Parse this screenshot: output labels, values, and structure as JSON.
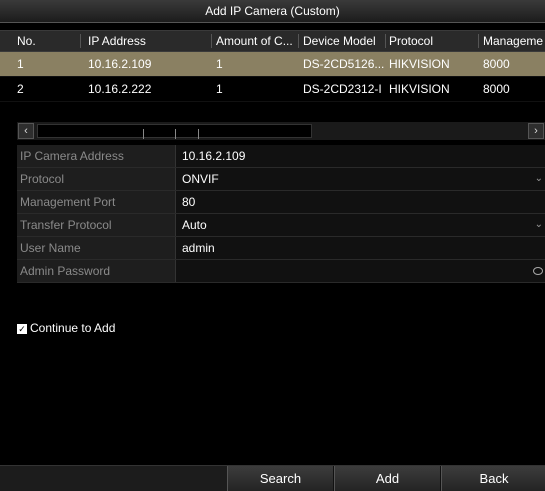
{
  "window": {
    "title": "Add IP Camera (Custom)"
  },
  "table": {
    "headers": [
      "No.",
      "IP Address",
      "Amount of C...",
      "Device Model",
      "Protocol",
      "Manageme"
    ],
    "rows": [
      {
        "no": "1",
        "ip": "10.16.2.109",
        "amount": "1",
        "model": "DS-2CD5126...",
        "protocol": "HIKVISION",
        "port": "8000"
      },
      {
        "no": "2",
        "ip": "10.16.2.222",
        "amount": "1",
        "model": "DS-2CD2312-I",
        "protocol": "HIKVISION",
        "port": "8000"
      }
    ]
  },
  "scrollbar": {
    "left": "‹",
    "right": "›"
  },
  "form": {
    "ip_label": "IP Camera Address",
    "ip_value": "10.16.2.109",
    "protocol_label": "Protocol",
    "protocol_value": "ONVIF",
    "port_label": "Management Port",
    "port_value": "80",
    "transfer_label": "Transfer Protocol",
    "transfer_value": "Auto",
    "user_label": "User Name",
    "user_value": "admin",
    "password_label": "Admin Password",
    "password_value": ""
  },
  "continue": {
    "label": "Continue to Add",
    "checked": true
  },
  "buttons": {
    "search": "Search",
    "add": "Add",
    "back": "Back"
  },
  "icons": {
    "dropdown": "chevron-down-icon",
    "password": "eye-icon",
    "check": "check-icon"
  }
}
